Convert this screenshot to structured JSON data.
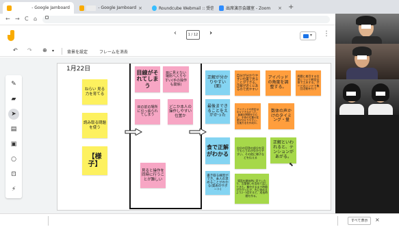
{
  "browser": {
    "tabs": [
      {
        "label": "- Google Jamboard",
        "fav": "jamboard-icon",
        "color": "#f9ab00"
      },
      {
        "label": "- Google Jamboard",
        "fav": "jamboard-icon",
        "color": "#f9ab00"
      },
      {
        "label": "Roundcube Webmail :: 受信箱",
        "fav": "roundcube-icon",
        "color": "#37beff"
      },
      {
        "label": "出席演示会議室 - Zoom",
        "fav": "zoom-icon",
        "color": "#2d8cff"
      }
    ],
    "new_tab": "+",
    "tab_close": "×"
  },
  "address": {
    "back": "←",
    "forward": "→",
    "reload": "C",
    "home": "⌂"
  },
  "jamboard": {
    "frame_prev": "‹",
    "frame_indicator": "1 / 12",
    "frame_next": "›",
    "more": "⋮"
  },
  "toolbar": {
    "undo": "↶",
    "redo": "↷",
    "zoom": "⊕",
    "zoom_caret": "▾",
    "set_background": "背景を設定",
    "clear_frame": "フレームを消去"
  },
  "board": {
    "date": "1月22日",
    "notes": [
      {
        "text": "ねらい 見る力を育てる",
        "color": "y"
      },
      {
        "text": "読み取る問題を使う",
        "color": "y"
      },
      {
        "text": "【様子】",
        "color": "y"
      },
      {
        "text": "目線がそれてしまう",
        "color": "p"
      },
      {
        "text": "目に見えない場所へ入りやすい(手の操作も関係)",
        "color": "p"
      },
      {
        "text": "目の前の場所に引っ張られてしまう",
        "color": "p"
      },
      {
        "text": "どこか本人の操作しやすい位置か",
        "color": "p"
      },
      {
        "text": "見ると操作を同時に行うことが難しい",
        "color": "p"
      },
      {
        "text": "正解が分かりやすい(面)",
        "color": "b"
      },
      {
        "text": "自分が分かりやすい位置で見ることができる。正解が近くにあるので見やすい",
        "color": "o"
      },
      {
        "text": "アイパッドの角度を調整する。",
        "color": "o"
      },
      {
        "text": "問題に着目する位置について教室全体で工夫する。ボードのハンドで集団活動を行う",
        "color": "o"
      },
      {
        "text": "最後まできることをえがかった",
        "color": "b"
      },
      {
        "text": "アイパッドの設定は中々できなかった。距離の問題を中心に、手首の位置の変更が分かりやすい。支援方法を作成中。",
        "color": "o"
      },
      {
        "text": "数体の声かけのタイミング・量",
        "color": "o"
      },
      {
        "text": "食で正解がわかる",
        "color": "b"
      },
      {
        "text": "自分の回答の部分を見てもらうのが分かりやすい、その他に様子などを伝える",
        "color": "g"
      },
      {
        "text": "正解といわれると、テンションがあがる。",
        "color": "g"
      },
      {
        "text": "書き取る練習ができ、本人の求めることがわかる(発表のサポート)",
        "color": "b"
      },
      {
        "text": "場面を開始時に見ていたり、言葉使いを含めて話してきた。集中するまで時間がかかったが、先に始めるよう2~3回すると、成長時間を作る。",
        "color": "g"
      }
    ]
  },
  "bottom": {
    "show_all": "すべて表示",
    "close": "×"
  }
}
